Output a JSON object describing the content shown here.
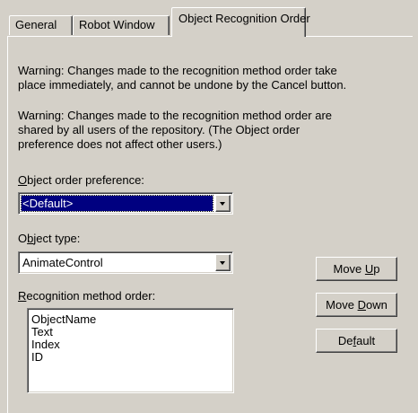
{
  "tabs": {
    "general": "General",
    "robot_window": "Robot Window",
    "object_recognition_order": "Object Recognition Order"
  },
  "warnings": {
    "warning1_line1": "Warning:  Changes made to the recognition method order take",
    "warning1_line2": "place immediately, and cannot be undone by the Cancel button.",
    "warning2_line1": "Warning: Changes made to the recognition method order are",
    "warning2_line2": "shared by all users of the repository.  (The Object order",
    "warning2_line3": "preference does not affect other users.)"
  },
  "object_order": {
    "label_underlined": "O",
    "label_rest": "bject order preference:",
    "value": "<Default>"
  },
  "object_type": {
    "label_first": "O",
    "label_underlined": "b",
    "label_rest": "ject type:",
    "value": "AnimateControl"
  },
  "recognition": {
    "label_underlined": "R",
    "label_rest": "ecognition method order:",
    "items": [
      "ObjectName",
      "Text",
      "Index",
      "ID"
    ]
  },
  "buttons": {
    "move_up_pre": "Move ",
    "move_up_ul": "U",
    "move_up_post": "p",
    "move_down_pre": "Move ",
    "move_down_ul": "D",
    "move_down_post": "own",
    "default_pre": "De",
    "default_ul": "f",
    "default_post": "ault"
  }
}
